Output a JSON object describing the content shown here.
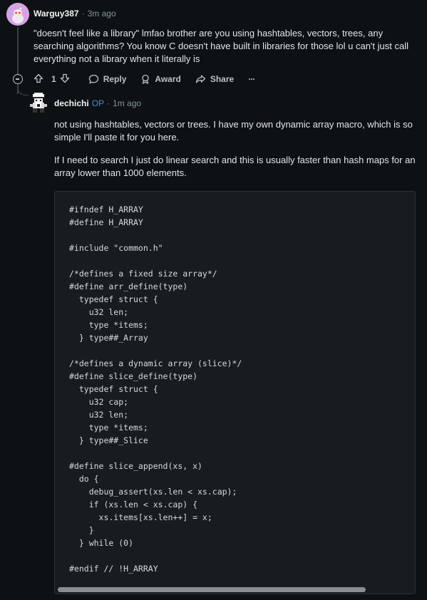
{
  "parent_comment": {
    "author": "Warguy387",
    "time": "3m ago",
    "text": "\"doesn't feel like a library\" lmfao brother are you using hashtables, vectors, trees, any searching algorithms? You know C doesn't have built in libraries for those lol u can't just call everything not a library when it literally is",
    "votes": "1",
    "reply_label": "Reply",
    "award_label": "Award",
    "share_label": "Share",
    "more_label": "···"
  },
  "reply_comment": {
    "author": "dechichi",
    "op_badge": "OP",
    "time": "1m ago",
    "paragraph1": "not using hashtables, vectors or trees. I have my own dynamic array macro, which is so simple I'll paste it for you here.",
    "paragraph2": "If I need to search I just do linear search and this is usually faster than hash maps for an array lower than 1000 elements.",
    "code": "#ifndef H_ARRAY\n#define H_ARRAY\n\n#include \"common.h\"\n\n/*defines a fixed size array*/\n#define arr_define(type)\n  typedef struct {\n    u32 len;\n    type *items;\n  } type##_Array\n\n/*defines a dynamic array (slice)*/\n#define slice_define(type)\n  typedef struct {\n    u32 cap;\n    u32 len;\n    type *items;\n  } type##_Slice\n\n#define slice_append(xs, x)\n  do {\n    debug_assert(xs.len < xs.cap);\n    if (xs.len < xs.cap) {\n      xs.items[xs.len++] = x;\n    }\n  } while (0)\n\n#endif // !H_ARRAY"
  },
  "colors": {
    "background": "#0e1113",
    "op_blue": "#3e8de8",
    "code_bg": "#181c1f"
  }
}
